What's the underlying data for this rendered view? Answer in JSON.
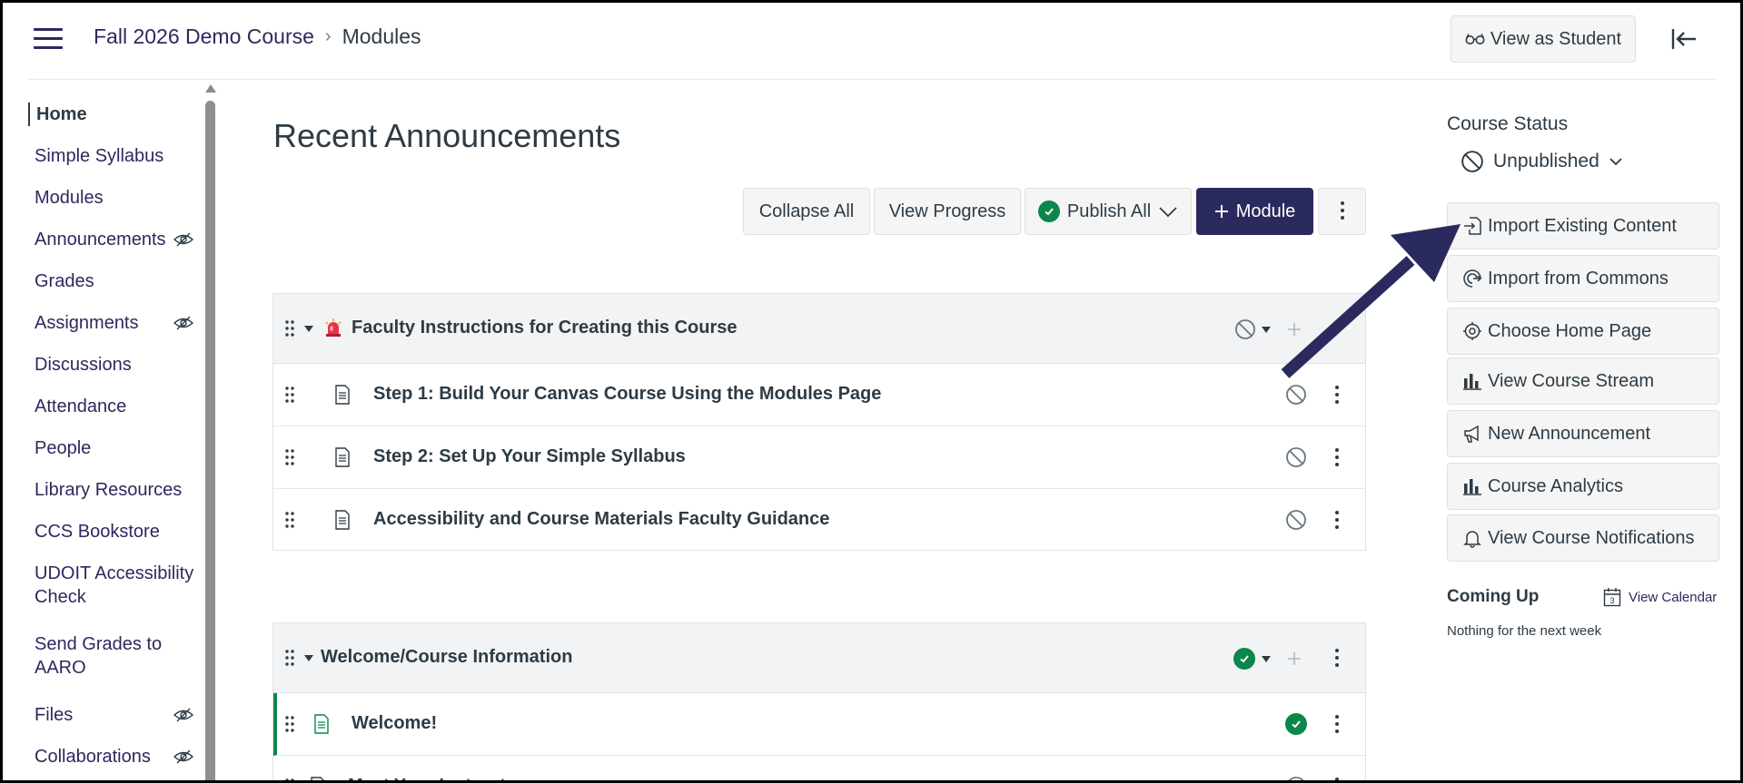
{
  "breadcrumb": {
    "course": "Fall 2026 Demo Course",
    "current": "Modules"
  },
  "header": {
    "view_as_student": "View as Student"
  },
  "nav": {
    "items": [
      {
        "label": "Home",
        "active": true,
        "hidden": false
      },
      {
        "label": "Simple Syllabus",
        "hidden": false
      },
      {
        "label": "Modules",
        "hidden": false
      },
      {
        "label": "Announcements",
        "hidden": true
      },
      {
        "label": "Grades",
        "hidden": false
      },
      {
        "label": "Assignments",
        "hidden": true
      },
      {
        "label": "Discussions",
        "hidden": false
      },
      {
        "label": "Attendance",
        "hidden": false
      },
      {
        "label": "People",
        "hidden": false
      },
      {
        "label": "Library Resources",
        "hidden": false
      },
      {
        "label": "CCS Bookstore",
        "hidden": false
      },
      {
        "label": "UDOIT Accessibility Check",
        "hidden": false
      },
      {
        "label": "Send Grades to AARO",
        "hidden": false
      },
      {
        "label": "Files",
        "hidden": true
      },
      {
        "label": "Collaborations",
        "hidden": true
      }
    ]
  },
  "main": {
    "title": "Recent Announcements",
    "toolbar": {
      "collapse_all": "Collapse All",
      "view_progress": "View Progress",
      "publish_all": "Publish All",
      "add_module": "Module"
    },
    "modules": [
      {
        "title": "Faculty Instructions for Creating this Course",
        "published": false,
        "items": [
          {
            "title": "Step 1: Build Your Canvas Course Using the Modules Page",
            "published": false
          },
          {
            "title": "Step 2: Set Up Your Simple Syllabus",
            "published": false
          },
          {
            "title": "Accessibility and Course Materials Faculty Guidance",
            "published": false
          }
        ]
      },
      {
        "title": "Welcome/Course Information",
        "published": true,
        "items": [
          {
            "title": "Welcome!",
            "published": true
          },
          {
            "title": "Meet Your Instructor",
            "published": false
          }
        ]
      }
    ]
  },
  "sidebar": {
    "course_status_label": "Course Status",
    "status_value": "Unpublished",
    "buttons": [
      {
        "label": "Import Existing Content",
        "icon": "import-icon"
      },
      {
        "label": "Import from Commons",
        "icon": "commons-icon"
      },
      {
        "label": "Choose Home Page",
        "icon": "target-icon"
      },
      {
        "label": "View Course Stream",
        "icon": "bar-chart-icon"
      },
      {
        "label": "New Announcement",
        "icon": "megaphone-icon"
      },
      {
        "label": "Course Analytics",
        "icon": "bar-chart-icon"
      },
      {
        "label": "View Course Notifications",
        "icon": "bell-icon"
      }
    ],
    "coming_up": "Coming Up",
    "view_calendar": "View Calendar",
    "calendar_day": "3",
    "nothing_upcoming": "Nothing for the next week"
  },
  "colors": {
    "brand": "#2b2a5e",
    "published": "#0b874b",
    "text": "#2d3b45"
  }
}
